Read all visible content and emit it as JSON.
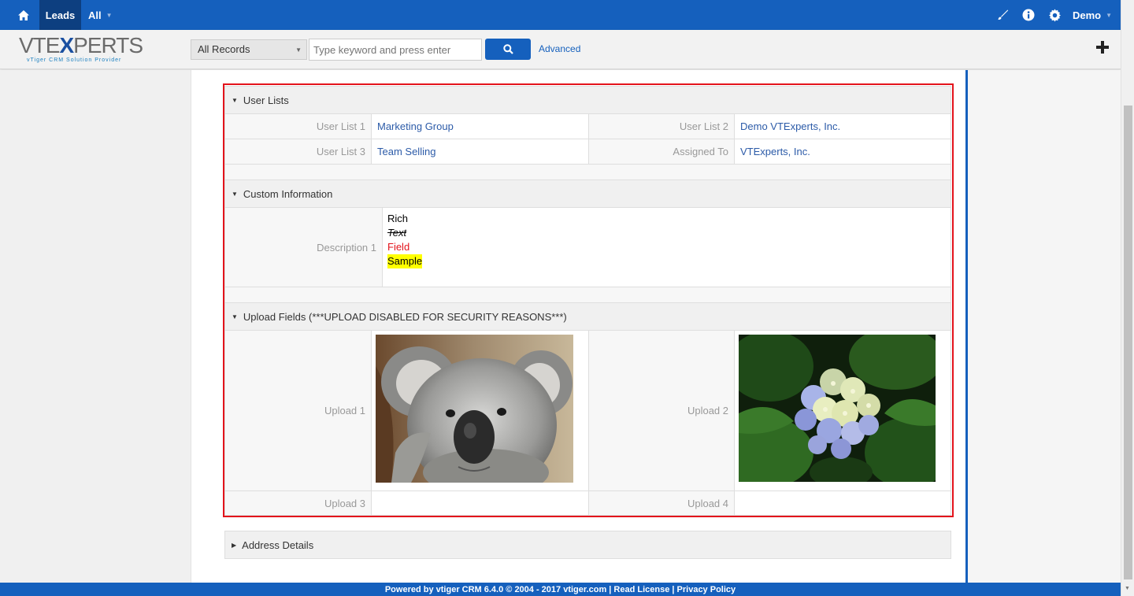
{
  "topnav": {
    "module": "Leads",
    "filter": "All",
    "user": "Demo"
  },
  "header": {
    "logo_main_pre": "VTE",
    "logo_main_x": "X",
    "logo_main_post": "PERTS",
    "logo_sub": "vTiger  CRM Solution Provider",
    "records_select": "All Records",
    "search_placeholder": "Type keyword and press enter",
    "advanced": "Advanced"
  },
  "blocks": {
    "user_lists": {
      "title": "User Lists",
      "rows": [
        {
          "l1": "User List 1",
          "v1": "Marketing Group",
          "l2": "User List 2",
          "v2": "Demo VTExperts, Inc."
        },
        {
          "l1": "User List 3",
          "v1": "Team Selling",
          "l2": "Assigned To",
          "v2": "VTExperts, Inc."
        }
      ]
    },
    "custom": {
      "title": "Custom Information",
      "label": "Description 1",
      "lines": [
        "Rich",
        "Text",
        "Field",
        "Sample"
      ]
    },
    "upload": {
      "title": "Upload Fields (***UPLOAD DISABLED FOR SECURITY REASONS***)",
      "labels": [
        "Upload 1",
        "Upload 2",
        "Upload 3",
        "Upload 4"
      ]
    },
    "address": {
      "title": "Address Details"
    }
  },
  "footer": "Powered by vtiger CRM 6.4.0  © 2004 - 2017  vtiger.com | Read License | Privacy Policy",
  "colors": {
    "primary": "#1560bd",
    "highlight_box": "#e3131b",
    "link": "#2c5ba8"
  }
}
